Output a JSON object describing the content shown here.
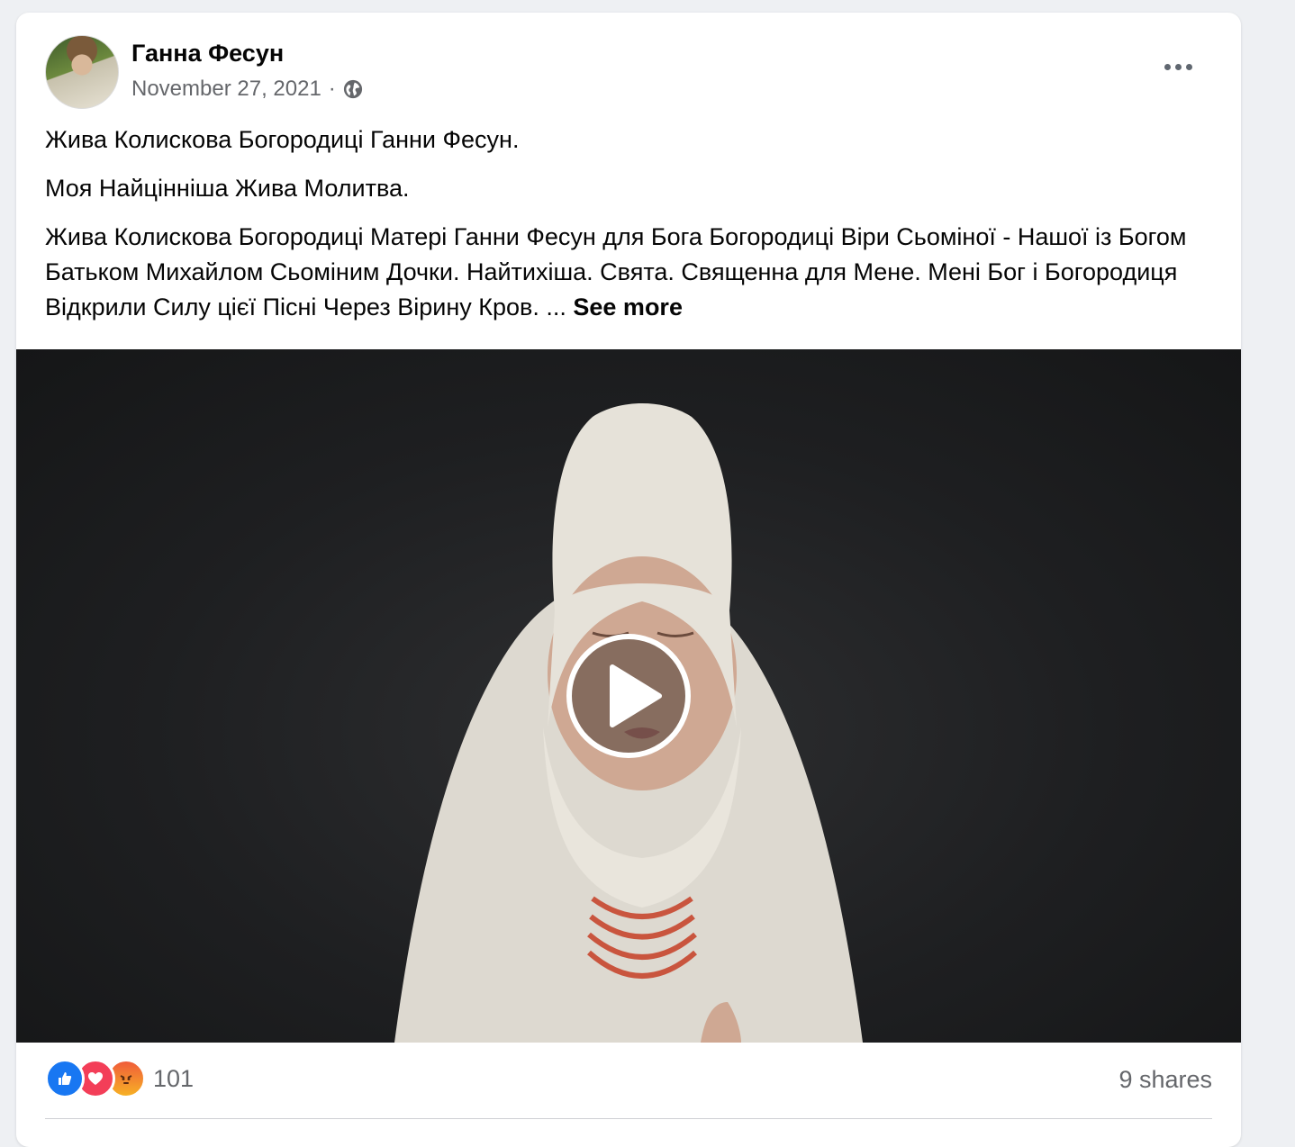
{
  "post": {
    "author": "Ганна Фесун",
    "date": "November 27, 2021",
    "separator": "·",
    "privacy_icon": "globe-icon",
    "paragraphs": [
      "Жива Колискова Богородиці Ганни Фесун.",
      "Моя Найцінніша Жива Молитва.",
      "Жива Колискова Богородиці Матері Ганни Фесун для Бога Богородиці Віри Сьоміної - Нашої із Богом Батьком Михайлом Сьоміним Дочки. Найтихіша. Свята. Священна для Мене. Мені Бог і Богородиця Відкрили Силу цієї Пісні Через Вірину Кров. ..."
    ],
    "see_more": "See more"
  },
  "video": {
    "play_icon": "play-icon"
  },
  "footer": {
    "reaction_icons": [
      "like-icon",
      "love-icon",
      "angry-icon"
    ],
    "reaction_count": "101",
    "shares": "9 shares"
  },
  "colors": {
    "like": "#1877f2",
    "love": "#f33e58",
    "angry": "#f05c3a",
    "secondary_text": "#65676b"
  }
}
